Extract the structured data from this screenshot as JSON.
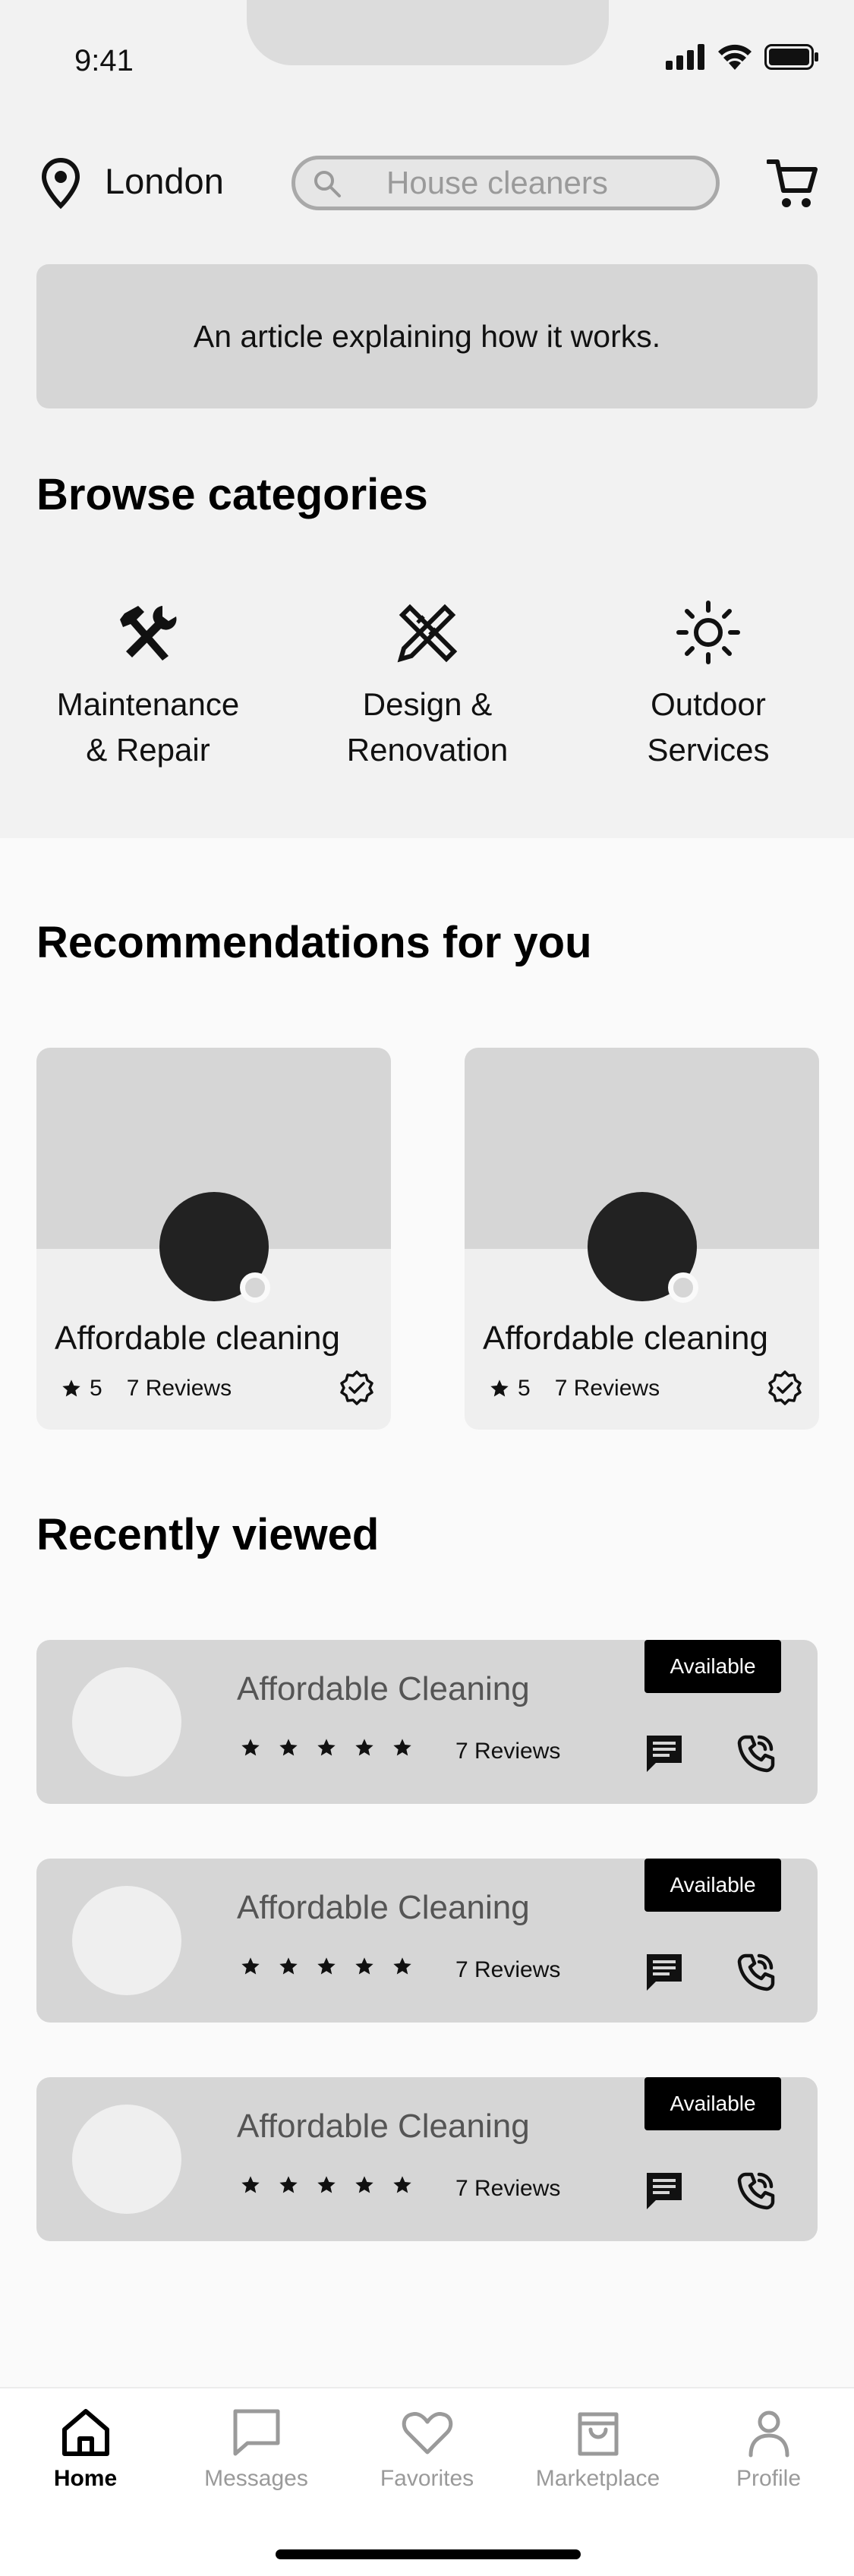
{
  "status": {
    "time": "9:41"
  },
  "location": {
    "label": "London"
  },
  "search": {
    "placeholder": "House cleaners"
  },
  "article": {
    "text": "An article explaining how it works."
  },
  "categories": {
    "title": "Browse categories",
    "items": [
      {
        "line1": "Maintenance",
        "line2": "& Repair",
        "icon": "tools-icon"
      },
      {
        "line1": "Design &",
        "line2": "Renovation",
        "icon": "design-icon"
      },
      {
        "line1": "Outdoor",
        "line2": "Services",
        "icon": "sun-icon"
      }
    ]
  },
  "recommendations": {
    "title": "Recommendations for you",
    "items": [
      {
        "title": "Affordable cleaning",
        "rating": "5",
        "reviews": "7 Reviews"
      },
      {
        "title": "Affordable cleaning",
        "rating": "5",
        "reviews": "7 Reviews"
      }
    ]
  },
  "recent": {
    "title": "Recently viewed",
    "items": [
      {
        "title": "Affordable Cleaning",
        "reviews": "7 Reviews",
        "badge": "Available",
        "stars": 5
      },
      {
        "title": "Affordable Cleaning",
        "reviews": "7 Reviews",
        "badge": "Available",
        "stars": 5
      },
      {
        "title": "Affordable Cleaning",
        "reviews": "7 Reviews",
        "badge": "Available",
        "stars": 5
      }
    ]
  },
  "tabs": [
    {
      "label": "Home",
      "icon": "home-icon",
      "active": true
    },
    {
      "label": "Messages",
      "icon": "messages-icon"
    },
    {
      "label": "Favorites",
      "icon": "heart-icon"
    },
    {
      "label": "Marketplace",
      "icon": "bag-icon"
    },
    {
      "label": "Profile",
      "icon": "profile-icon"
    }
  ]
}
